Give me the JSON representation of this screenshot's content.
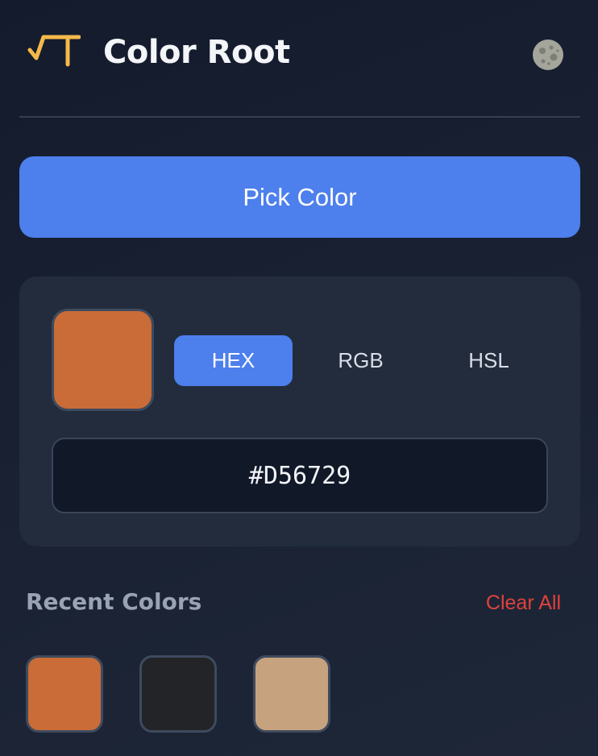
{
  "header": {
    "title": "Color Root",
    "logo_icon": "sqrt-t-logo-icon",
    "theme_icon": "moon-icon"
  },
  "pick_button": {
    "label": "Pick Color"
  },
  "current_color": {
    "hex": "#D56729",
    "swatch_color": "#c96c37"
  },
  "format_tabs": [
    {
      "label": "HEX",
      "active": true
    },
    {
      "label": "RGB",
      "active": false
    },
    {
      "label": "HSL",
      "active": false
    }
  ],
  "recent": {
    "title": "Recent Colors",
    "clear_label": "Clear All",
    "colors": [
      "#c96c37",
      "#232427",
      "#c7a27f"
    ]
  },
  "colors": {
    "accent": "#4d7fed",
    "logo": "#f5b94a",
    "danger": "#e0413b",
    "background": "#161d2e",
    "card": "#222c3d"
  }
}
